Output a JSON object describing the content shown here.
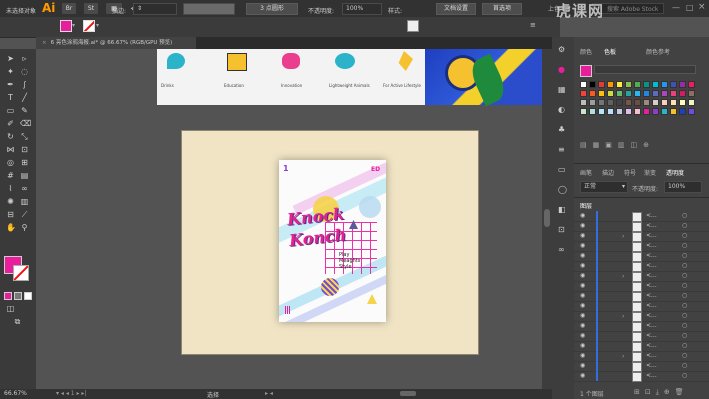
{
  "app": {
    "logo": "Ai"
  },
  "menubar": {
    "workspace": "上色",
    "search_placeholder": "搜索 Adobe Stock",
    "watermark": "虎课网"
  },
  "control": {
    "selection_status": "未选择对象",
    "stroke_label": "描边:",
    "brush_value": "3 点圆形",
    "opacity_label": "不透明度:",
    "opacity_value": "100%",
    "style_label": "样式:",
    "doc_setup": "文档设置",
    "preferences": "首选项"
  },
  "document": {
    "tab_title": "6 亮色涂鸦海报.ai* @ 66.67% (RGB/GPU 预览)"
  },
  "top_strip": {
    "labels": [
      "Drinks",
      "Education",
      "Innovation",
      "Lightweight Animals",
      "For Active Lifestyle"
    ]
  },
  "poster": {
    "corner_num": "1",
    "corner_tag": "ED",
    "title_line1": "Knock",
    "title_line2": "Konch",
    "sub1": "Play",
    "sub2": "Meaghts",
    "sub3": "Style"
  },
  "status": {
    "zoom": "66.67%",
    "tool": "选择"
  },
  "panel": {
    "tabs_top": [
      "颜色",
      "色板",
      "颜色参考"
    ],
    "tabs_mid": [
      "画笔",
      "描边",
      "符号",
      "渐变",
      "透明度"
    ],
    "blend_mode": "正常",
    "opacity_label": "不透明度:",
    "opacity_value": "100%",
    "layers_title": "图层",
    "layer_label": "<...",
    "layer_count": "1 个图层"
  },
  "colors": {
    "fill": "#e91e9c",
    "accent_orange": "#ff9a00",
    "artboard": "#f0e4c4"
  }
}
